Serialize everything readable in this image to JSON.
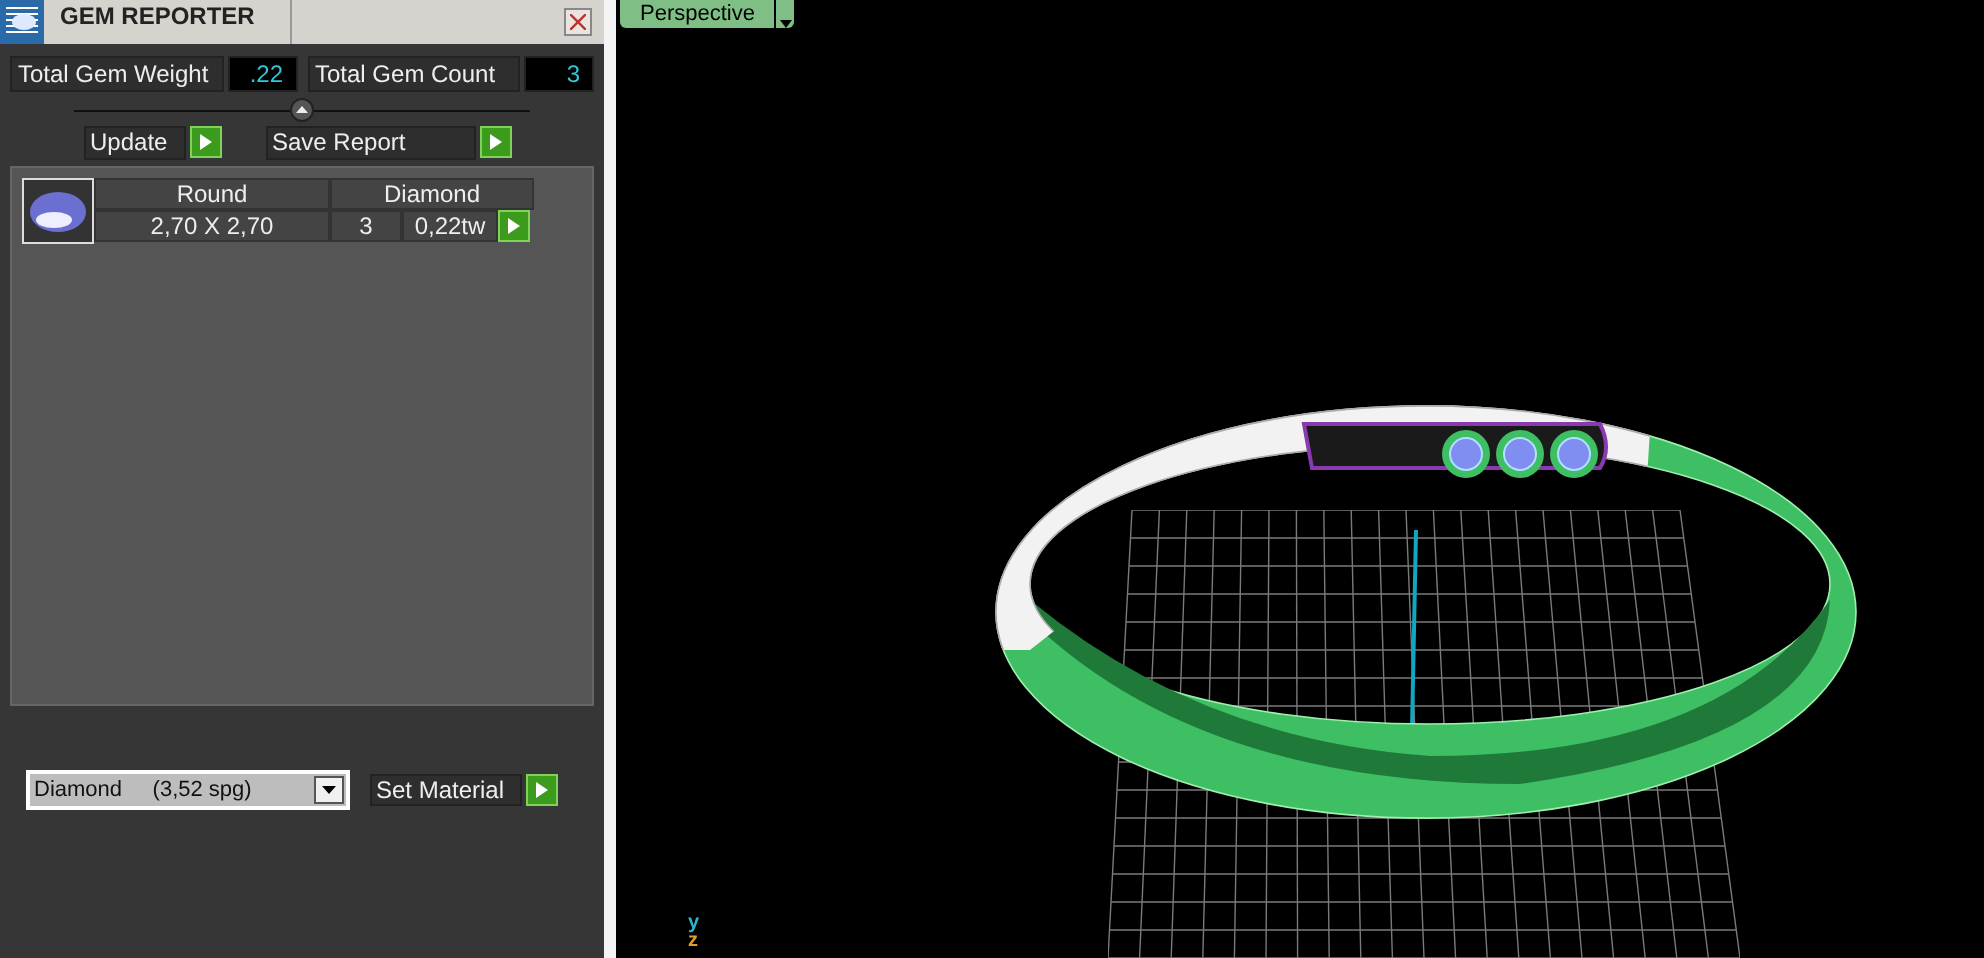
{
  "panel": {
    "title": "GEM REPORTER",
    "totals": [
      {
        "label": "Total Gem Weight",
        "value": ".22"
      },
      {
        "label": "Total Gem Count",
        "value": "3"
      }
    ],
    "buttons": [
      "Update",
      "Save Report"
    ],
    "gems": [
      {
        "shape": "Round",
        "material": "Diamond",
        "size": "2,70 X 2,70",
        "count": "3",
        "weight": "0,22tw"
      }
    ],
    "material_select": {
      "value": "Diamond     (3,52 spg)"
    },
    "set_button": "Set Material"
  },
  "viewport": {
    "view_tab": "Perspective",
    "axes": [
      "y",
      "z"
    ]
  }
}
